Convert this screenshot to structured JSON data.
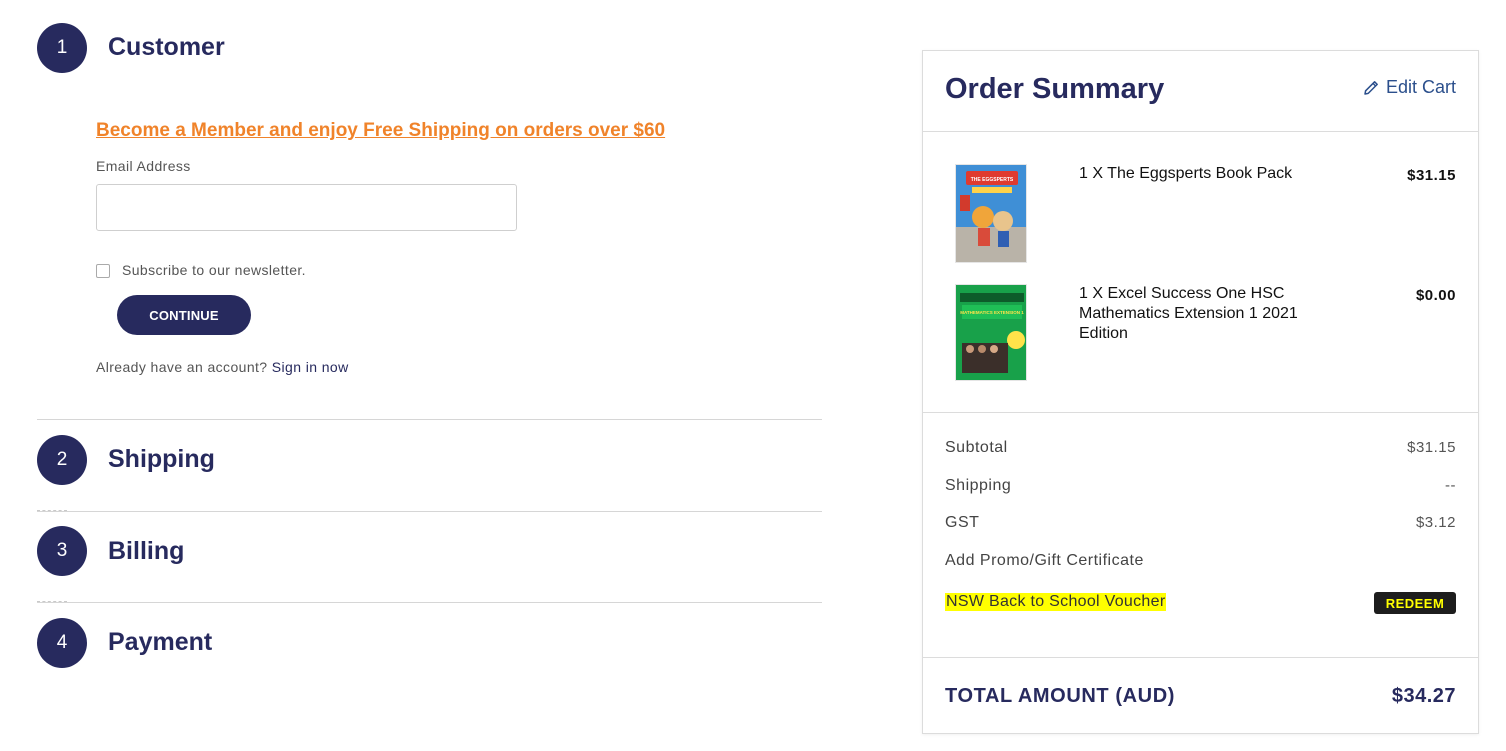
{
  "steps": [
    {
      "number": "1",
      "title": "Customer"
    },
    {
      "number": "2",
      "title": "Shipping"
    },
    {
      "number": "3",
      "title": "Billing"
    },
    {
      "number": "4",
      "title": "Payment"
    }
  ],
  "customer": {
    "member_link": "Become a Member and enjoy Free Shipping on orders over $60",
    "email_label": "Email Address",
    "email_value": "",
    "newsletter_label": "Subscribe to our newsletter.",
    "newsletter_checked": false,
    "continue_label": "CONTINUE",
    "account_prompt": "Already have an account?",
    "signin_label": "Sign in now"
  },
  "summary": {
    "title": "Order Summary",
    "edit_cart_label": "Edit Cart",
    "edit_icon": "pencil-icon",
    "items": [
      {
        "name": "1 X The Eggsperts Book Pack",
        "price": "$31.15",
        "thumb_cover_text": "THE EGGSPERTS"
      },
      {
        "name": "1 X Excel Success One HSC Mathematics Extension 1 2021 Edition",
        "price": "$0.00",
        "thumb_cover_text": "MATHEMATICS EXTENSION 1"
      }
    ],
    "subtotal_label": "Subtotal",
    "subtotal_value": "$31.15",
    "shipping_label": "Shipping",
    "shipping_value": "--",
    "gst_label": "GST",
    "gst_value": "$3.12",
    "promo_label": "Add Promo/Gift Certificate",
    "voucher_label": "NSW Back to School Voucher",
    "redeem_label": "REDEEM",
    "total_label": "TOTAL AMOUNT (AUD)",
    "total_value": "$34.27"
  },
  "colors": {
    "brand_navy": "#272a5e",
    "member_orange": "#f0832a",
    "voucher_highlight": "#ffff00",
    "redeem_bg": "#1d1d1d"
  }
}
